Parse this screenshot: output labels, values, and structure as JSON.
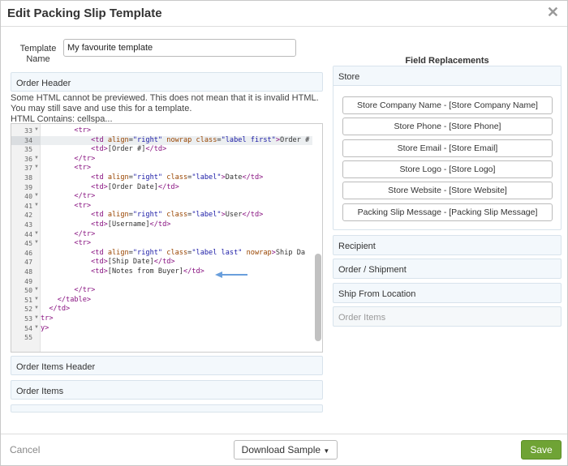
{
  "header": {
    "title": "Edit Packing Slip Template",
    "close_glyph": "✕"
  },
  "form": {
    "name_label": "Template Name",
    "name_value": "My favourite template"
  },
  "sections": {
    "order_header": "Order Header",
    "order_items_header": "Order Items Header",
    "order_items": "Order Items"
  },
  "warning": {
    "line1": "Some HTML cannot be previewed. This does not mean that it is invalid HTML. You may still save and use this for a template.",
    "line2": "HTML Contains: cellspa..."
  },
  "editor": {
    "lines": [
      {
        "n": "33",
        "fold": true,
        "html": "        <span class=\"tag\">&lt;tr&gt;</span>"
      },
      {
        "n": "34",
        "fold": false,
        "active": true,
        "html": "            <span class=\"tag\">&lt;td</span> <span class=\"attr\">align</span>=<span class=\"val\">\"right\"</span> <span class=\"attr\">nowrap</span> <span class=\"attr\">class</span>=<span class=\"val\">\"label first\"</span><span class=\"tag\">&gt;</span>Order #"
      },
      {
        "n": "35",
        "fold": false,
        "html": "            <span class=\"tag\">&lt;td&gt;</span>[Order #]<span class=\"tag\">&lt;/td&gt;</span>"
      },
      {
        "n": "36",
        "fold": true,
        "html": "        <span class=\"tag\">&lt;/tr&gt;</span>"
      },
      {
        "n": "37",
        "fold": true,
        "html": "        <span class=\"tag\">&lt;tr&gt;</span>"
      },
      {
        "n": "38",
        "fold": false,
        "html": "            <span class=\"tag\">&lt;td</span> <span class=\"attr\">align</span>=<span class=\"val\">\"right\"</span> <span class=\"attr\">class</span>=<span class=\"val\">\"label\"</span><span class=\"tag\">&gt;</span>Date<span class=\"tag\">&lt;/td&gt;</span>"
      },
      {
        "n": "39",
        "fold": false,
        "html": "            <span class=\"tag\">&lt;td&gt;</span>[Order Date]<span class=\"tag\">&lt;/td&gt;</span>"
      },
      {
        "n": "40",
        "fold": true,
        "html": "        <span class=\"tag\">&lt;/tr&gt;</span>"
      },
      {
        "n": "41",
        "fold": true,
        "html": "        <span class=\"tag\">&lt;tr&gt;</span>"
      },
      {
        "n": "42",
        "fold": false,
        "html": "            <span class=\"tag\">&lt;td</span> <span class=\"attr\">align</span>=<span class=\"val\">\"right\"</span> <span class=\"attr\">class</span>=<span class=\"val\">\"label\"</span><span class=\"tag\">&gt;</span>User<span class=\"tag\">&lt;/td&gt;</span>"
      },
      {
        "n": "43",
        "fold": false,
        "html": "            <span class=\"tag\">&lt;td&gt;</span>[Username]<span class=\"tag\">&lt;/td&gt;</span>"
      },
      {
        "n": "44",
        "fold": true,
        "html": "        <span class=\"tag\">&lt;/tr&gt;</span>"
      },
      {
        "n": "45",
        "fold": true,
        "html": "        <span class=\"tag\">&lt;tr&gt;</span>"
      },
      {
        "n": "46",
        "fold": false,
        "html": "            <span class=\"tag\">&lt;td</span> <span class=\"attr\">align</span>=<span class=\"val\">\"right\"</span> <span class=\"attr\">class</span>=<span class=\"val\">\"label last\"</span> <span class=\"attr\">nowrap</span><span class=\"tag\">&gt;</span>Ship Da"
      },
      {
        "n": "47",
        "fold": false,
        "html": "            <span class=\"tag\">&lt;td&gt;</span>[Ship Date]<span class=\"tag\">&lt;/td&gt;</span>"
      },
      {
        "n": "48",
        "fold": false,
        "html": "            <span class=\"tag\">&lt;td&gt;</span>[Notes from Buyer]<span class=\"tag\">&lt;/td&gt;</span>"
      },
      {
        "n": "49",
        "fold": false,
        "html": ""
      },
      {
        "n": "50",
        "fold": true,
        "html": "        <span class=\"tag\">&lt;/tr&gt;</span>"
      },
      {
        "n": "51",
        "fold": true,
        "html": "    <span class=\"tag\">&lt;/table&gt;</span>"
      },
      {
        "n": "52",
        "fold": true,
        "html": "  <span class=\"tag\">&lt;/td&gt;</span>"
      },
      {
        "n": "53",
        "fold": true,
        "html": "<span class=\"tag\">tr&gt;</span>"
      },
      {
        "n": "54",
        "fold": true,
        "html": "<span class=\"tag\">y&gt;</span>"
      },
      {
        "n": "55",
        "fold": false,
        "html": ""
      }
    ]
  },
  "field_replacements": {
    "title": "Field Replacements",
    "store_label": "Store",
    "buttons": [
      "Store Company Name - [Store Company Name]",
      "Store Phone - [Store Phone]",
      "Store Email - [Store Email]",
      "Store Logo - [Store Logo]",
      "Store Website - [Store Website]",
      "Packing Slip Message - [Packing Slip Message]"
    ],
    "recipient": "Recipient",
    "order_shipment": "Order / Shipment",
    "ship_from": "Ship From Location",
    "order_items": "Order Items"
  },
  "footer": {
    "cancel": "Cancel",
    "download": "Download Sample",
    "save": "Save"
  },
  "colors": {
    "accent_green": "#6fa335",
    "arrow_blue": "#6a9fdc"
  }
}
